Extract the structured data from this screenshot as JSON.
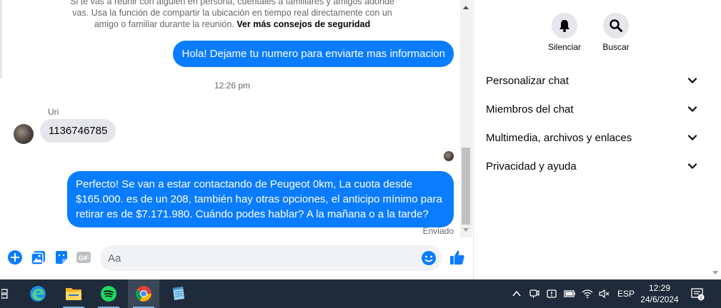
{
  "chat": {
    "safety_notice": {
      "line1": "Si te vas a reunir con alguien en persona, cuéntales a familiares y amigos adónde",
      "line2": "vas. Usa la función de compartir la ubicación en tiempo real directamente con un",
      "line3_prefix": "amigo o familiar durante la reunión.",
      "link": "Ver más consejos de seguridad"
    },
    "messages": {
      "first_outgoing": "Hola! Dejame tu numero para enviarte mas informacion",
      "timestamp": "12:26 pm",
      "sender_name": "Uri",
      "incoming": "1136746785",
      "second_outgoing": "Perfecto!  Se van a estar contactando de Peugeot 0km, La cuota desde $165.000. es de un 208, también hay otras opciones, el anticipo mínimo para retirar es de $7.171.980. Cuándo podes hablar? A la mañana o a la tarde?",
      "status": "Enviado"
    },
    "composer": {
      "placeholder": "Aa"
    }
  },
  "sidebar": {
    "actions": [
      {
        "label": "Silenciar",
        "icon": "bell-icon"
      },
      {
        "label": "Buscar",
        "icon": "search-icon"
      }
    ],
    "menu": [
      {
        "label": "Personalizar chat"
      },
      {
        "label": "Miembros del chat"
      },
      {
        "label": "Multimedia, archivos y enlaces"
      },
      {
        "label": "Privacidad y ayuda"
      }
    ]
  },
  "taskbar": {
    "language": "ESP",
    "time": "12:29",
    "date": "24/6/2024",
    "notification_count": "1"
  },
  "colors": {
    "accent": "#0a7cff",
    "incoming_bubble": "#e4e6eb",
    "taskbar": "#1f2b3a"
  }
}
